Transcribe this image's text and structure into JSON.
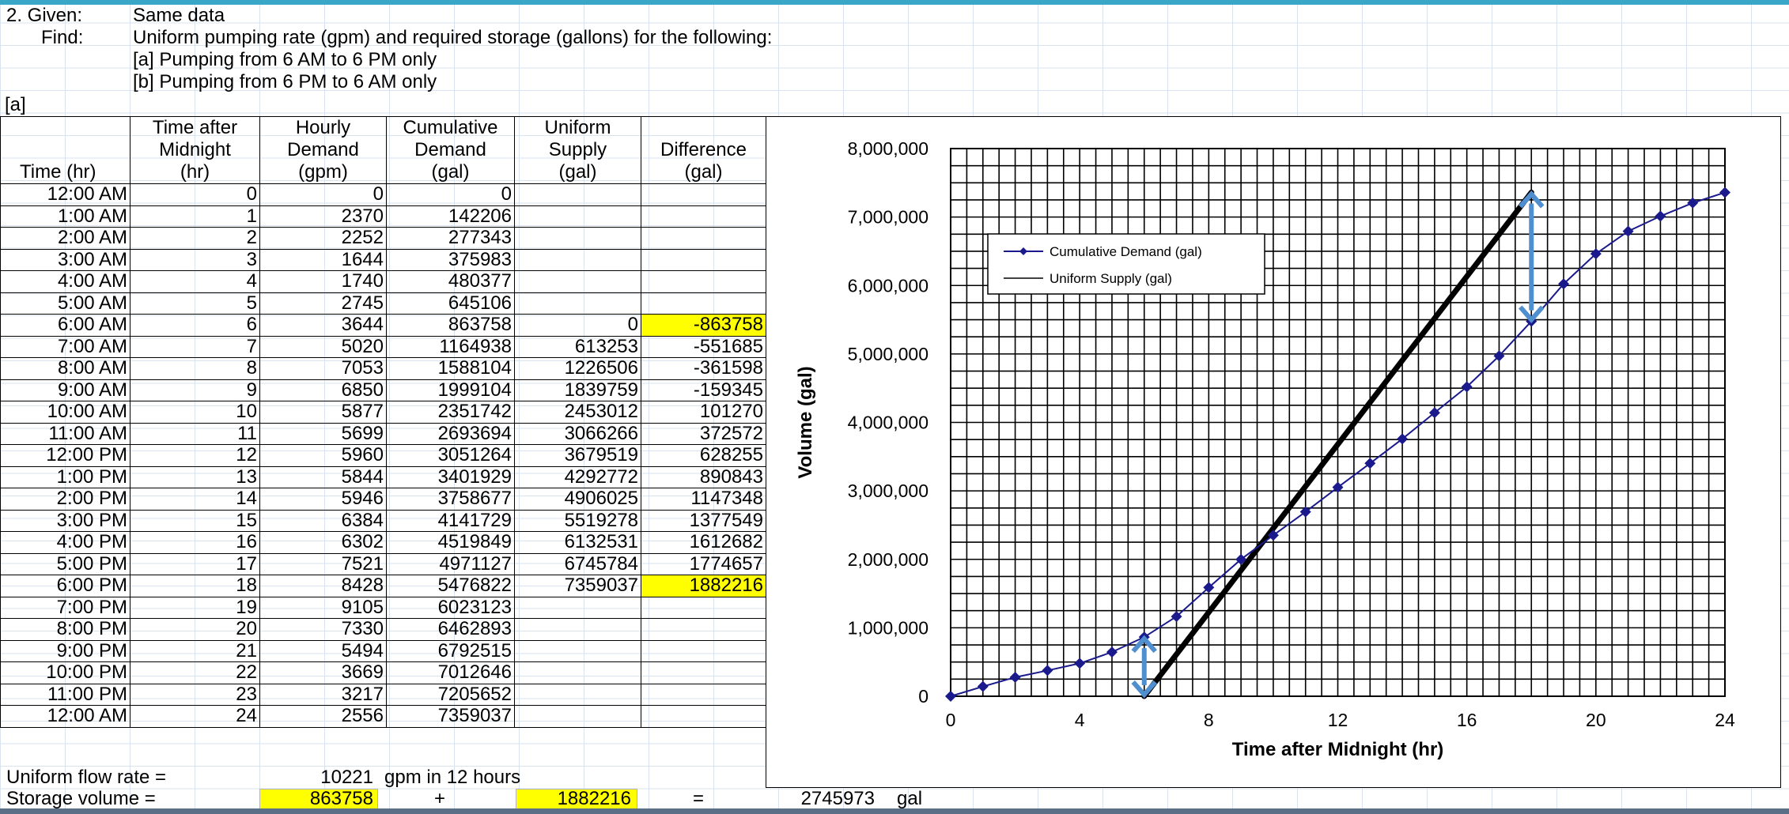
{
  "header": {
    "given_label": "2.  Given:",
    "given_text": "Same data",
    "find_label": "Find:",
    "find_text": "Uniform pumping rate (gpm) and required storage (gallons) for the following:",
    "item_a": "[a] Pumping from 6 AM to 6 PM only",
    "item_b": "[b] Pumping from 6 PM to 6 AM only",
    "part_label": "[a]"
  },
  "table": {
    "headers": [
      [
        "",
        "",
        "Time (hr)"
      ],
      [
        "Time after",
        "Midnight",
        "(hr)"
      ],
      [
        "Hourly",
        "Demand",
        "(gpm)"
      ],
      [
        "Cumulative",
        "Demand",
        "(gal)"
      ],
      [
        "Uniform",
        "Supply",
        "(gal)"
      ],
      [
        "",
        "Difference",
        "(gal)"
      ]
    ],
    "rows": [
      [
        "12:00 AM",
        "0",
        "0",
        "0",
        "",
        ""
      ],
      [
        "1:00 AM",
        "1",
        "2370",
        "142206",
        "",
        ""
      ],
      [
        "2:00 AM",
        "2",
        "2252",
        "277343",
        "",
        ""
      ],
      [
        "3:00 AM",
        "3",
        "1644",
        "375983",
        "",
        ""
      ],
      [
        "4:00 AM",
        "4",
        "1740",
        "480377",
        "",
        ""
      ],
      [
        "5:00 AM",
        "5",
        "2745",
        "645106",
        "",
        ""
      ],
      [
        "6:00 AM",
        "6",
        "3644",
        "863758",
        "0",
        "-863758"
      ],
      [
        "7:00 AM",
        "7",
        "5020",
        "1164938",
        "613253",
        "-551685"
      ],
      [
        "8:00 AM",
        "8",
        "7053",
        "1588104",
        "1226506",
        "-361598"
      ],
      [
        "9:00 AM",
        "9",
        "6850",
        "1999104",
        "1839759",
        "-159345"
      ],
      [
        "10:00 AM",
        "10",
        "5877",
        "2351742",
        "2453012",
        "101270"
      ],
      [
        "11:00 AM",
        "11",
        "5699",
        "2693694",
        "3066266",
        "372572"
      ],
      [
        "12:00 PM",
        "12",
        "5960",
        "3051264",
        "3679519",
        "628255"
      ],
      [
        "1:00 PM",
        "13",
        "5844",
        "3401929",
        "4292772",
        "890843"
      ],
      [
        "2:00 PM",
        "14",
        "5946",
        "3758677",
        "4906025",
        "1147348"
      ],
      [
        "3:00 PM",
        "15",
        "6384",
        "4141729",
        "5519278",
        "1377549"
      ],
      [
        "4:00 PM",
        "16",
        "6302",
        "4519849",
        "6132531",
        "1612682"
      ],
      [
        "5:00 PM",
        "17",
        "7521",
        "4971127",
        "6745784",
        "1774657"
      ],
      [
        "6:00 PM",
        "18",
        "8428",
        "5476822",
        "7359037",
        "1882216"
      ],
      [
        "7:00 PM",
        "19",
        "9105",
        "6023123",
        "",
        ""
      ],
      [
        "8:00 PM",
        "20",
        "7330",
        "6462893",
        "",
        ""
      ],
      [
        "9:00 PM",
        "21",
        "5494",
        "6792515",
        "",
        ""
      ],
      [
        "10:00 PM",
        "22",
        "3669",
        "7012646",
        "",
        ""
      ],
      [
        "11:00 PM",
        "23",
        "3217",
        "7205652",
        "",
        ""
      ],
      [
        "12:00 AM",
        "24",
        "2556",
        "7359037",
        "",
        ""
      ]
    ],
    "highlighted_cells": [
      [
        6,
        5
      ],
      [
        18,
        5
      ]
    ],
    "highlight_color": "#ffff00"
  },
  "footer": {
    "flow_label": "Uniform flow rate =",
    "flow_value": "10221",
    "flow_unit": "gpm in 12 hours",
    "storage_label": "Storage volume =",
    "storage_a": "863758",
    "plus": "+",
    "storage_b": "1882216",
    "equals": "=",
    "storage_total": "2745973",
    "storage_unit": "gal"
  },
  "chart_data": {
    "type": "line",
    "xlabel": "Time after Midnight (hr)",
    "ylabel": "Volume (gal)",
    "xlim": [
      0,
      24
    ],
    "ylim": [
      0,
      8000000
    ],
    "xticks": [
      "0",
      "4",
      "8",
      "12",
      "16",
      "20",
      "24"
    ],
    "yticks": [
      "0",
      "1,000,000",
      "2,000,000",
      "3,000,000",
      "4,000,000",
      "5,000,000",
      "6,000,000",
      "7,000,000",
      "8,000,000"
    ],
    "grid": true,
    "legend_position": "top-left",
    "series": [
      {
        "name": "Cumulative Demand (gal)",
        "color": "#1a1a8c",
        "marker": "diamond",
        "x": [
          0,
          1,
          2,
          3,
          4,
          5,
          6,
          7,
          8,
          9,
          10,
          11,
          12,
          13,
          14,
          15,
          16,
          17,
          18,
          19,
          20,
          21,
          22,
          23,
          24
        ],
        "y": [
          0,
          142206,
          277343,
          375983,
          480377,
          645106,
          863758,
          1164938,
          1588104,
          1999104,
          2351742,
          2693694,
          3051264,
          3401929,
          3758677,
          4141729,
          4519849,
          4971127,
          5476822,
          6023123,
          6462893,
          6792515,
          7012646,
          7205652,
          7359037
        ]
      },
      {
        "name": "Uniform Supply (gal)",
        "color": "#000000",
        "marker": "none",
        "x": [
          6,
          18
        ],
        "y": [
          0,
          7359037
        ]
      }
    ],
    "arrows": [
      {
        "x": 6,
        "y_from": 0,
        "y_to": 863758,
        "color": "#4f8fcf"
      },
      {
        "x": 18,
        "y_from": 5476822,
        "y_to": 7359037,
        "color": "#4f8fcf"
      }
    ]
  }
}
